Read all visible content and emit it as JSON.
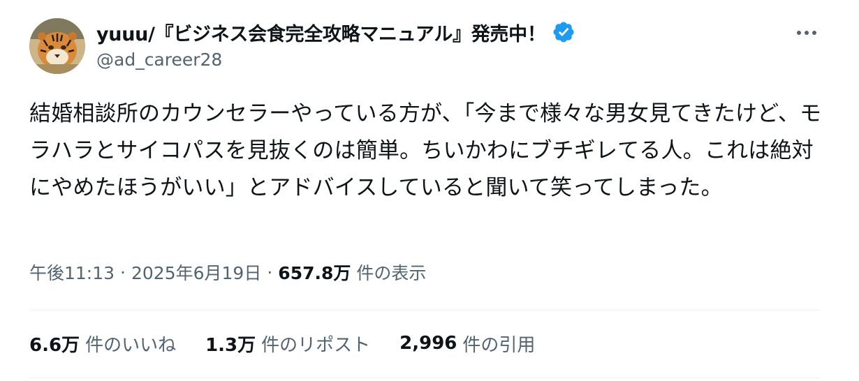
{
  "author": {
    "display_name": "yuuu/『ビジネス会食完全攻略マニュアル』発売中！",
    "handle": "@ad_career28",
    "verified_color": "#1d9bf0",
    "avatar_icon": "tiger-avatar"
  },
  "tweet": {
    "text": "結婚相談所のカウンセラーやっている方が、「今まで様々な男女見てきたけど、モラハラとサイコパスを見抜くのは簡単。ちいかわにブチギレてる人。これは絶対にやめたほうがいい」とアドバイスしていると聞いて笑ってしまった。"
  },
  "meta": {
    "time": "午後11:13",
    "separator": "·",
    "date": "2025年6月19日",
    "views_count": "657.8万",
    "views_label": "件の表示"
  },
  "stats": {
    "likes_count": "6.6万",
    "likes_label": "件のいいね",
    "reposts_count": "1.3万",
    "reposts_label": "件のリポスト",
    "quotes_count": "2,996",
    "quotes_label": "件の引用"
  },
  "colors": {
    "text_primary": "#0f1419",
    "text_secondary": "#536471",
    "divider": "#eff3f4",
    "accent": "#1d9bf0"
  }
}
